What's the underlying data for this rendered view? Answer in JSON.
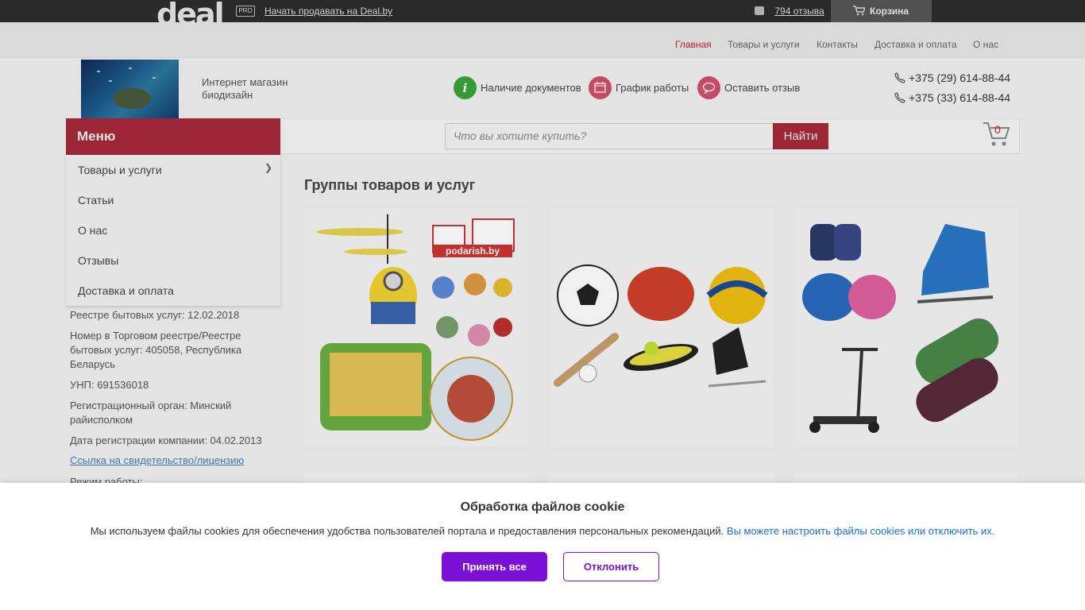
{
  "topbar": {
    "logo": "deal",
    "pro_badge": "PRO",
    "sell_link": "Начать продавать на Deal.by",
    "reviews_link": "794 отзыва",
    "cart_label": "Корзина"
  },
  "nav": {
    "items": [
      {
        "label": "Главная",
        "active": true
      },
      {
        "label": "Товары и услуги",
        "active": false
      },
      {
        "label": "Контакты",
        "active": false
      },
      {
        "label": "Доставка и оплата",
        "active": false
      },
      {
        "label": "О нас",
        "active": false
      }
    ]
  },
  "header": {
    "shop_name": "Интернет магазин биодизайн",
    "features": [
      {
        "label": "Наличие документов",
        "icon": "info-icon",
        "color": "#3aa53a"
      },
      {
        "label": "График работы",
        "icon": "calendar-icon",
        "color": "#d0506a"
      },
      {
        "label": "Оставить отзыв",
        "icon": "comment-icon",
        "color": "#d0506a"
      }
    ],
    "phones": [
      "+375 (29) 614-88-44",
      "+375 (33) 614-88-44"
    ]
  },
  "menu": {
    "title": "Меню",
    "items": [
      "Товары и услуги",
      "Статьи",
      "О нас",
      "Отзывы",
      "Доставка и оплата"
    ]
  },
  "search": {
    "placeholder": "Что вы хотите купить?",
    "button": "Найти",
    "cart_count": "0"
  },
  "sidebar": {
    "lines": [
      "Реестре бытовых услуг: 12.02.2018",
      "Номер в Торговом реестре/Реестре бытовых услуг: 405058, Республика Беларусь",
      "УНП: 691536018",
      "Регистрационный орган: Минский райисполком",
      "Дата регистрации компании: 04.02.2013"
    ],
    "license_link": "Ссылка на свидетельство/лицензию",
    "hours_label": "Режим работы:"
  },
  "main": {
    "title": "Группы товаров и услуг",
    "card_brand": "podarish.by"
  },
  "cookie": {
    "title": "Обработка файлов cookie",
    "text": "Мы используем файлы cookies для обеспечения удобства пользователей портала и предоставления персональных рекомендаций.",
    "link": "Вы можете настроить файлы cookies или отключить их.",
    "accept": "Принять все",
    "decline": "Отклонить"
  },
  "colors": {
    "brand": "#a8283a",
    "cookie_accent": "#7c0fd8",
    "link": "#1a6ed8"
  }
}
